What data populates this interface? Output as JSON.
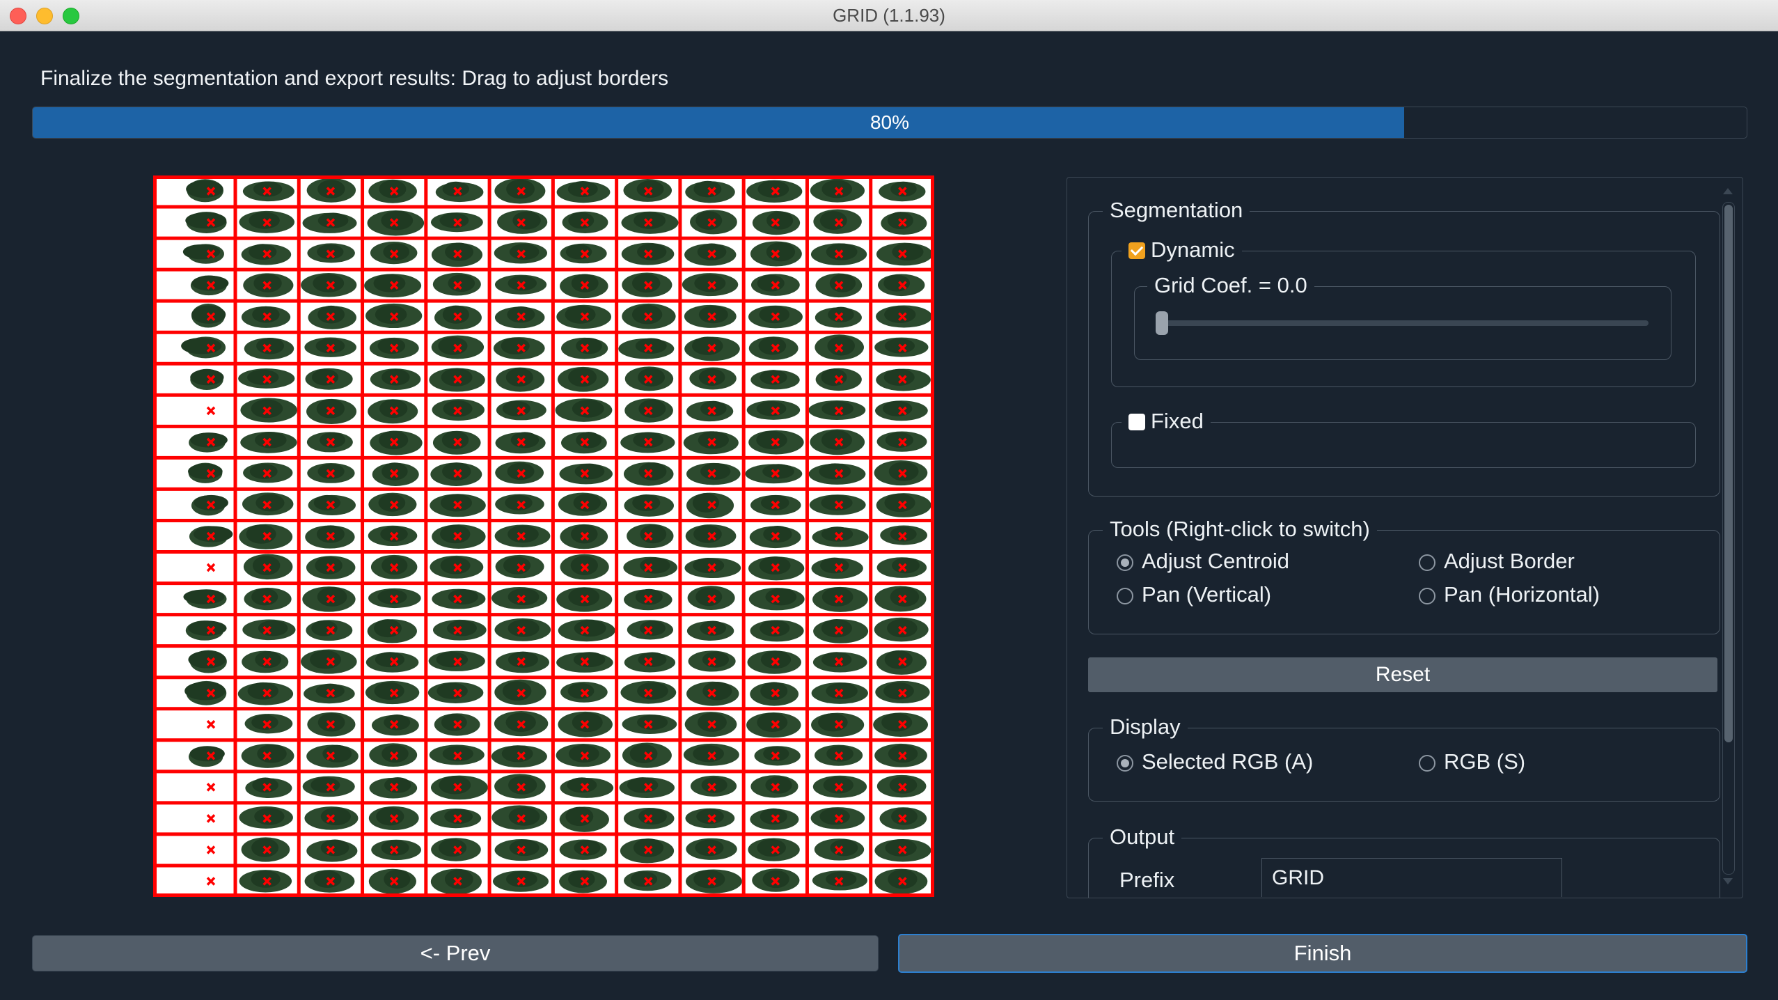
{
  "window": {
    "title": "GRID (1.1.93)"
  },
  "instruction": "Finalize the segmentation and export results: Drag to adjust borders",
  "progress": {
    "value": 0.8,
    "label": "80%"
  },
  "plot_grid": {
    "rows": 23,
    "cols": 12,
    "border_color": "#ff0000",
    "plant_color": "#2c4a2e",
    "empty_cells": [
      [
        7,
        0
      ],
      [
        12,
        0
      ],
      [
        17,
        0
      ],
      [
        19,
        0
      ],
      [
        20,
        0
      ],
      [
        21,
        0
      ],
      [
        22,
        0
      ]
    ]
  },
  "segmentation": {
    "title": "Segmentation",
    "dynamic": {
      "label": "Dynamic",
      "checked": true
    },
    "grid_coef": {
      "label": "Grid Coef. = 0.0",
      "value": 0.0
    },
    "fixed": {
      "label": "Fixed",
      "checked": false
    }
  },
  "tools": {
    "title": "Tools (Right-click to switch)",
    "options": [
      {
        "label": "Adjust Centroid",
        "selected": true
      },
      {
        "label": "Adjust Border",
        "selected": false
      },
      {
        "label": "Pan (Vertical)",
        "selected": false
      },
      {
        "label": "Pan (Horizontal)",
        "selected": false
      }
    ]
  },
  "reset_label": "Reset",
  "display": {
    "title": "Display",
    "options": [
      {
        "label": "Selected RGB (A)",
        "selected": true
      },
      {
        "label": "RGB (S)",
        "selected": false
      }
    ]
  },
  "output": {
    "title": "Output",
    "prefix_label": "Prefix",
    "prefix_value": "GRID"
  },
  "buttons": {
    "prev": "<- Prev",
    "finish": "Finish"
  },
  "colors": {
    "accent": "#1d63a6",
    "checkbox": "#f1a11e",
    "focus_border": "#2c7fd0",
    "background": "#19232f"
  }
}
